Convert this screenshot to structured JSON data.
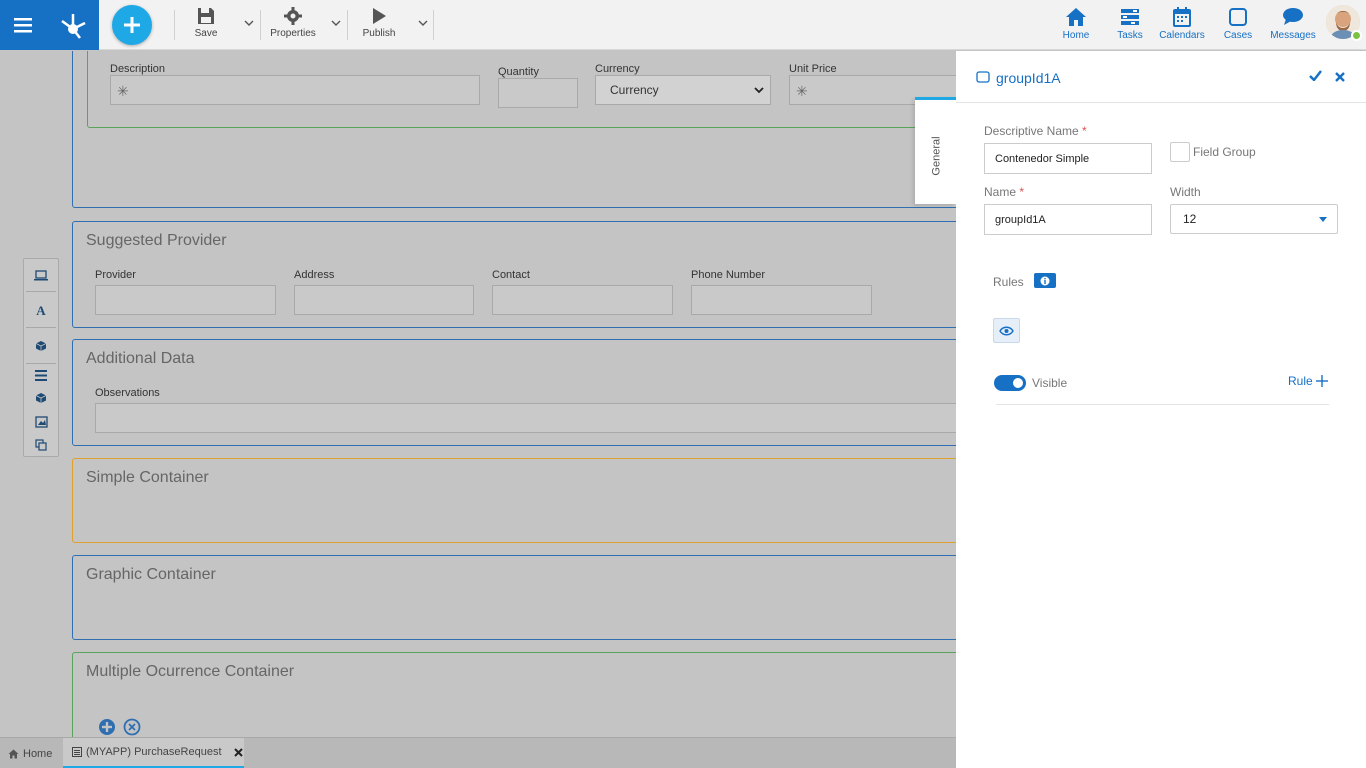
{
  "toolbar": {
    "save_label": "Save",
    "properties_label": "Properties",
    "publish_label": "Publish"
  },
  "nav": {
    "home": "Home",
    "tasks": "Tasks",
    "calendars": "Calendars",
    "cases": "Cases",
    "messages": "Messages"
  },
  "canvas": {
    "items_container": {
      "description_label": "Description",
      "quantity_label": "Quantity",
      "currency_label": "Currency",
      "currency_value": "Currency",
      "unit_price_label": "Unit Price"
    },
    "suggested_provider": {
      "title": "Suggested Provider",
      "fields": [
        "Provider",
        "Address",
        "Contact",
        "Phone Number"
      ]
    },
    "additional_data": {
      "title": "Additional Data",
      "observations_label": "Observations"
    },
    "simple_container": {
      "title": "Simple Container"
    },
    "graphic_container": {
      "title": "Graphic Container"
    },
    "multiple_container": {
      "title": "Multiple Ocurrence Container"
    }
  },
  "bottom_tabs": {
    "home": "Home",
    "document": "(MYAPP) PurchaseRequest"
  },
  "panel": {
    "title": "groupId1A",
    "tab_general": "General",
    "descriptive_name_label": "Descriptive Name",
    "descriptive_name_value": "Contenedor Simple",
    "field_group_label": "Field Group",
    "name_label": "Name",
    "name_value": "groupId1A",
    "width_label": "Width",
    "width_value": "12",
    "rules_label": "Rules",
    "visible_label": "Visible",
    "rule_add_label": "Rule"
  },
  "colors": {
    "brand_blue": "#1670c4",
    "accent_cyan": "#1ea9e6",
    "simple_container_border": "#e0a12c",
    "multiple_container_border": "#5aa35a"
  }
}
